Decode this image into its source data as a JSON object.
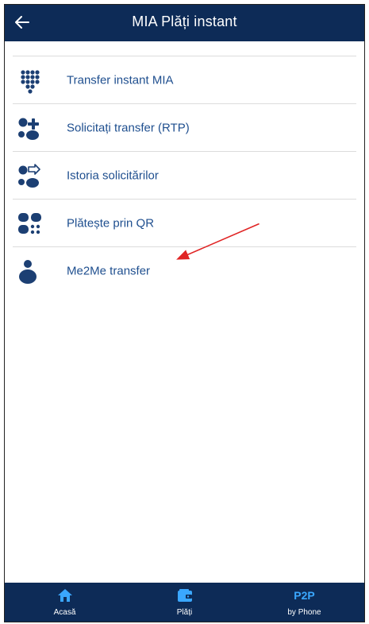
{
  "header": {
    "title": "MIA Plăți instant"
  },
  "menu": {
    "items": [
      {
        "label": "Transfer instant MIA",
        "icon": "keypad-dots-icon"
      },
      {
        "label": "Solicitați transfer (RTP)",
        "icon": "request-transfer-icon"
      },
      {
        "label": "Istoria solicitărilor",
        "icon": "request-history-icon"
      },
      {
        "label": "Plătește prin QR",
        "icon": "qr-pay-icon"
      },
      {
        "label": "Me2Me transfer",
        "icon": "person-icon"
      }
    ]
  },
  "bottom_nav": {
    "home": {
      "label": "Acasă",
      "icon": "home-icon"
    },
    "payments": {
      "label": "Plăți",
      "icon": "wallet-icon"
    },
    "p2p": {
      "badge": "P2P",
      "label": "by Phone"
    }
  },
  "colors": {
    "bar": "#0d2b57",
    "menu_text": "#1f4f8f",
    "icon": "#1c3f73",
    "accent": "#3aa7ff",
    "annotation_arrow": "#e02424"
  }
}
